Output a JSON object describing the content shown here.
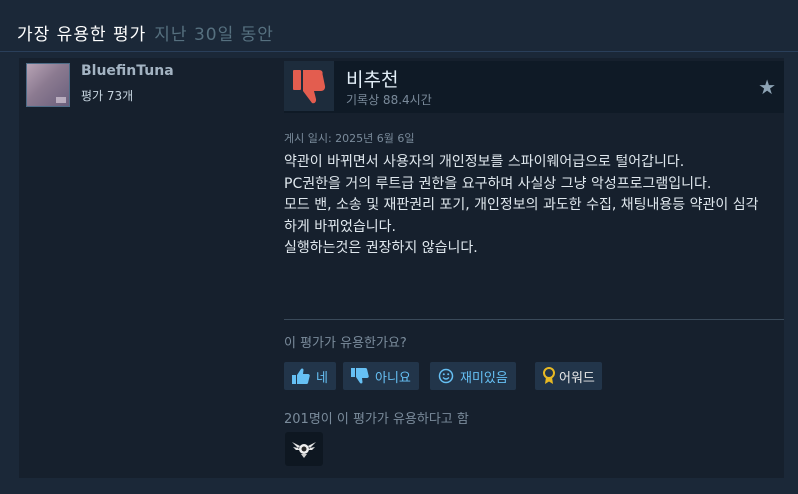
{
  "header": {
    "title": "가장 유용한 평가",
    "subtitle": "지난 30일 동안"
  },
  "author": {
    "name": "BluefinTuna",
    "review_count": "평가 73개"
  },
  "review": {
    "verdict": "비추천",
    "hours": "기록상 88.4시간",
    "posted": "게시 일시: 2025년 6월 6일",
    "body_lines": [
      "약관이 바뀌면서 사용자의 개인정보를 스파이웨어급으로 털어갑니다.",
      "PC권한을 거의 루트급 권한을 요구하며 사실상 그냥 악성프로그램입니다.",
      "모드 밴, 소송 및 재판권리 포기, 개인정보의 과도한 수집, 채팅내용등 약관이 심각하게 바뀌었습니다.",
      "실행하는것은 권장하지 않습니다."
    ]
  },
  "helpful": {
    "question": "이 평가가 유용한가요?",
    "yes_label": "네",
    "no_label": "아니요",
    "funny_label": "재미있음",
    "award_label": "어워드",
    "count_text": "201명이 이 평가가 유용하다고 함"
  },
  "icons": {
    "thumb_down": "thumbs-down-icon",
    "star": "star-icon",
    "thumb_up_small": "thumbs-up-icon",
    "thumb_down_small": "thumbs-down-icon",
    "smile": "smiley-icon",
    "award": "award-medal-icon",
    "award_badge": "winged-award-badge-icon"
  },
  "colors": {
    "background": "#1b2838",
    "panel": "#16202d",
    "accent_blue": "#66c0f4",
    "thumb_down_red": "#e35d4f",
    "award_gold": "#e8b923"
  }
}
